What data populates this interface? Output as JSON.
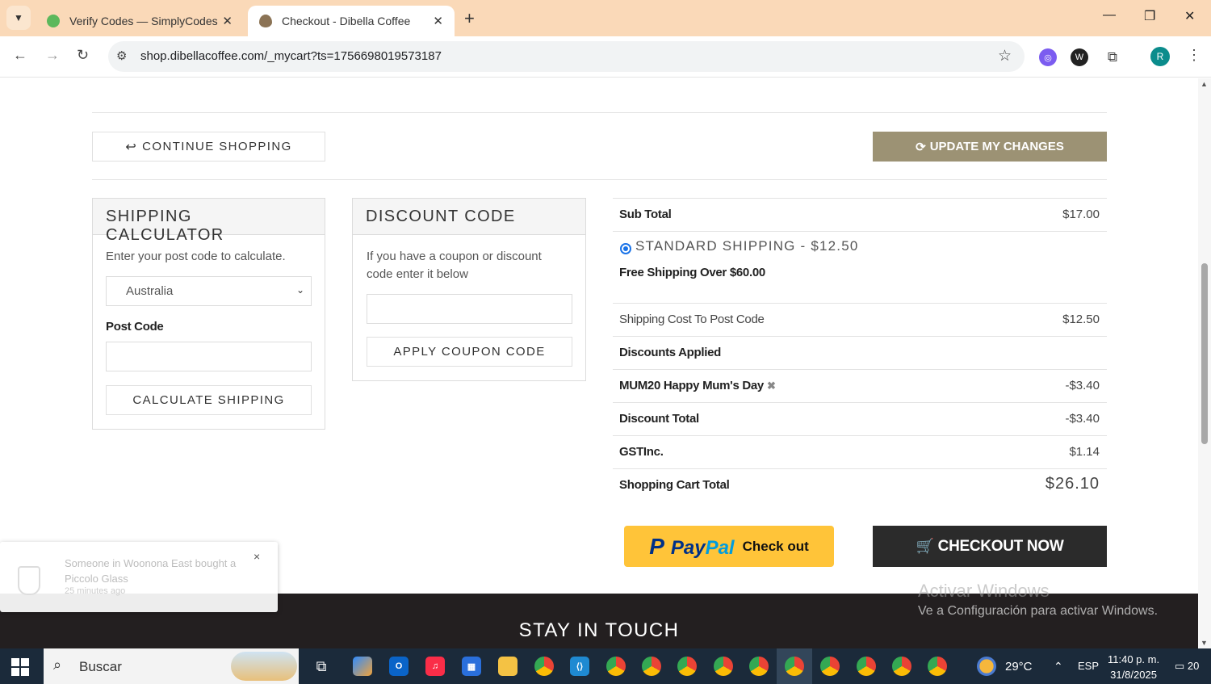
{
  "browser": {
    "tabs": [
      {
        "title": "Verify Codes — SimplyCodes",
        "active": false
      },
      {
        "title": "Checkout - Dibella Coffee",
        "active": true
      }
    ],
    "url": "shop.dibellacoffee.com/_mycart?ts=1756698019573187",
    "profile_initial": "R"
  },
  "cart": {
    "continue_label": "CONTINUE SHOPPING",
    "update_label": "UPDATE MY CHANGES"
  },
  "shipping_calculator": {
    "title": "SHIPPING CALCULATOR",
    "instruction": "Enter your post code to calculate.",
    "country": "Australia",
    "post_code_label": "Post Code",
    "post_code_value": "",
    "button": "CALCULATE SHIPPING"
  },
  "discount": {
    "title": "DISCOUNT CODE",
    "instruction": "If you have a coupon or discount code enter it below",
    "code_value": "",
    "button": "APPLY COUPON CODE"
  },
  "summary": {
    "subtotal_label": "Sub Total",
    "subtotal": "$17.00",
    "shipping_option": "STANDARD SHIPPING - $12.50",
    "free_shipping": "Free Shipping Over $60.00",
    "shipping_cost_label": "Shipping Cost To Post Code",
    "shipping_cost": "$12.50",
    "discounts_label": "Discounts Applied",
    "coupon_label": "MUM20 Happy Mum's Day",
    "coupon_value": "-$3.40",
    "discount_total_label": "Discount Total",
    "discount_total": "-$3.40",
    "gst_label": "GSTInc.",
    "gst": "$1.14",
    "total_label": "Shopping Cart Total",
    "total": "$26.10"
  },
  "payment": {
    "paypal_pay": "Pay",
    "paypal_pal": "Pal",
    "paypal_text": "Check out",
    "checkout_label": "CHECKOUT NOW"
  },
  "footer": {
    "title": "STAY IN TOUCH"
  },
  "toast": {
    "message": "Someone in Woonona East bought a Piccolo Glass",
    "time": "25 minutes ago"
  },
  "watermark": {
    "line1": "Activar Windows",
    "line2": "Ve a Configuración para activar Windows."
  },
  "taskbar": {
    "search_label": "Buscar",
    "weather": "29°C",
    "language": "ESP",
    "time": "11:40 p. m.",
    "date": "31/8/2025",
    "notifications": "20"
  },
  "colors": {
    "update_button": "#9c9274",
    "checkout_button": "#2b2b2b",
    "paypal": "#ffc439",
    "footer": "#231f20"
  }
}
